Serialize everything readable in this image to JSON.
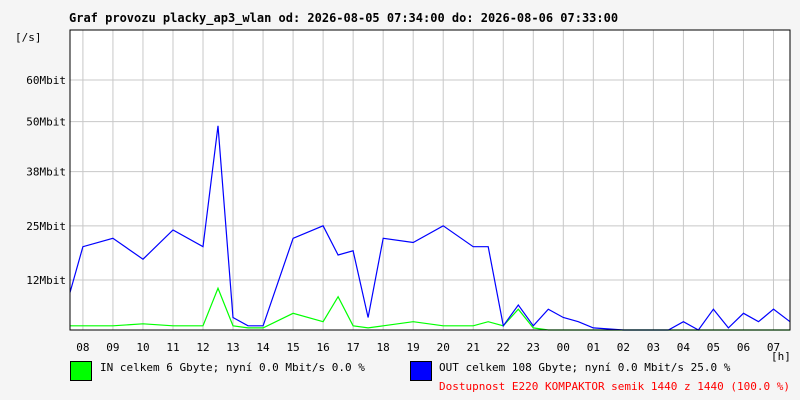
{
  "title": "Graf provozu placky_ap3_wlan od: 2026-08-05 07:34:00 do: 2026-08-06 07:33:00",
  "colors": {
    "in": "#00ff00",
    "out": "#0000ff",
    "grid": "#c8c8c8",
    "availability": "#ff0000",
    "background": "#f5f5f5",
    "plot_bg": "#ffffff"
  },
  "legend": {
    "in_text": "IN celkem 6 Gbyte; nyní   0.0 Mbit/s 0.0 %",
    "out_text": "OUT celkem 108 Gbyte; nyní   0.0 Mbit/s 25.0 %",
    "availability": "Dostupnost E220 KOMPAKTOR semik 1440 z 1440 (100.0 %)"
  },
  "chart_data": {
    "type": "line",
    "title": "Graf provozu placky_ap3_wlan od: 2026-08-05 07:34:00 do: 2026-08-06 07:33:00",
    "ylabel": "[/s]",
    "xlabel": "[h]",
    "x_unit": "h",
    "y_unit": "Mbit",
    "ylim": [
      0,
      60
    ],
    "grid": true,
    "y_ticks": [
      {
        "value": 12,
        "label": "12Mbit"
      },
      {
        "value": 25,
        "label": "25Mbit"
      },
      {
        "value": 38,
        "label": "38Mbit"
      },
      {
        "value": 50,
        "label": "50Mbit"
      },
      {
        "value": 60,
        "label": "60Mbit"
      }
    ],
    "x_ticks": [
      "08",
      "09",
      "10",
      "11",
      "12",
      "13",
      "14",
      "15",
      "16",
      "17",
      "18",
      "19",
      "20",
      "21",
      "22",
      "23",
      "00",
      "01",
      "02",
      "03",
      "04",
      "05",
      "06",
      "07"
    ],
    "x_hours": [
      7.57,
      8,
      9,
      10,
      11,
      12,
      12.5,
      13,
      13.5,
      14,
      15,
      16,
      16.5,
      17,
      17.5,
      18,
      19,
      20,
      21,
      21.5,
      22,
      22.5,
      23,
      23.5,
      24,
      24.5,
      25,
      26,
      27,
      27.5,
      28,
      28.5,
      29,
      29.5,
      30,
      30.5,
      31,
      31.55
    ],
    "series": [
      {
        "name": "IN",
        "color": "#00ff00",
        "values": [
          1,
          1,
          1,
          1.5,
          1,
          1,
          10,
          1,
          0.5,
          0.5,
          4,
          2,
          8,
          1,
          0.5,
          1,
          2,
          1,
          1,
          2,
          1,
          5,
          0.5,
          0,
          0,
          0,
          0,
          0,
          0,
          0,
          0,
          0,
          0,
          0,
          0,
          0,
          0,
          0
        ]
      },
      {
        "name": "OUT",
        "color": "#0000ff",
        "values": [
          9,
          20,
          22,
          17,
          24,
          20,
          49,
          3,
          1,
          1,
          22,
          25,
          18,
          19,
          3,
          22,
          21,
          25,
          20,
          20,
          1,
          6,
          1,
          5,
          3,
          2,
          0.5,
          0,
          0,
          0,
          2,
          0,
          5,
          0.5,
          4,
          2,
          5,
          2
        ]
      }
    ]
  }
}
